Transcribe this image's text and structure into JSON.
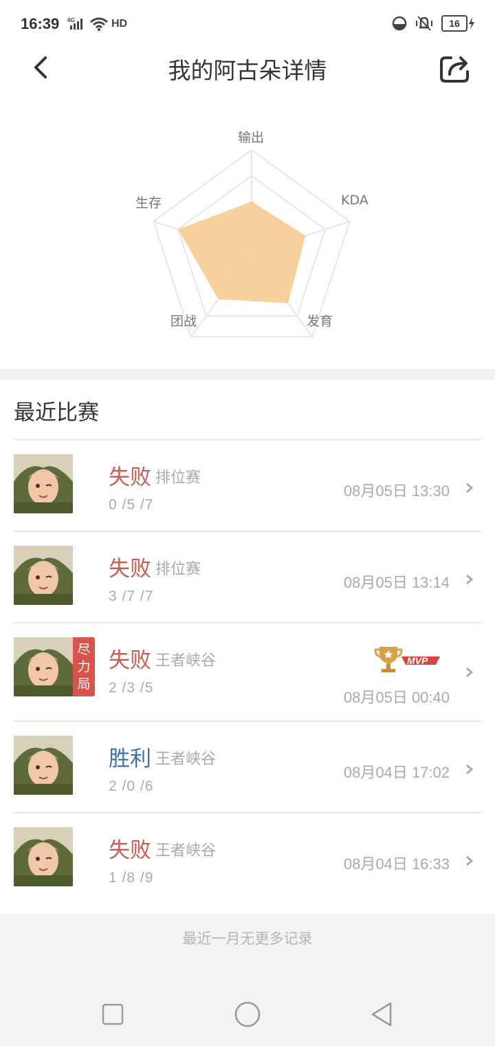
{
  "status": {
    "time": "16:39",
    "network": "4G",
    "hd": "HD",
    "battery": "16"
  },
  "header": {
    "title": "我的阿古朵详情"
  },
  "radar": {
    "labels": {
      "output": "输出",
      "kda": "KDA",
      "growth": "发育",
      "team": "团战",
      "survival": "生存"
    },
    "values": {
      "output": 0.5,
      "kda": 0.55,
      "growth": 0.6,
      "team": 0.55,
      "survival": 0.75
    },
    "fill_color": "#f5c98a"
  },
  "section": {
    "title": "最近比赛"
  },
  "matches": [
    {
      "result": "失败",
      "mode": "排位赛",
      "kda": "0 /5 /7",
      "time": "08月05日 13:30"
    },
    {
      "result": "失败",
      "mode": "排位赛",
      "kda": "3 /7 /7",
      "time": "08月05日 13:14"
    },
    {
      "result": "失败",
      "mode": "王者峡谷",
      "kda": "2 /3 /5",
      "time": "08月05日 00:40",
      "badge": "尽力局",
      "mvp": "MVP"
    },
    {
      "result": "胜利",
      "mode": "王者峡谷",
      "kda": "2 /0 /6",
      "time": "08月04日 17:02"
    },
    {
      "result": "失败",
      "mode": "王者峡谷",
      "kda": "1 /8 /9",
      "time": "08月04日 16:33"
    }
  ],
  "footer": {
    "note": "最近一月无更多记录"
  },
  "colors": {
    "loss": "#cc5b4f",
    "win": "#3c6fb6",
    "badge": "#d9534a"
  }
}
